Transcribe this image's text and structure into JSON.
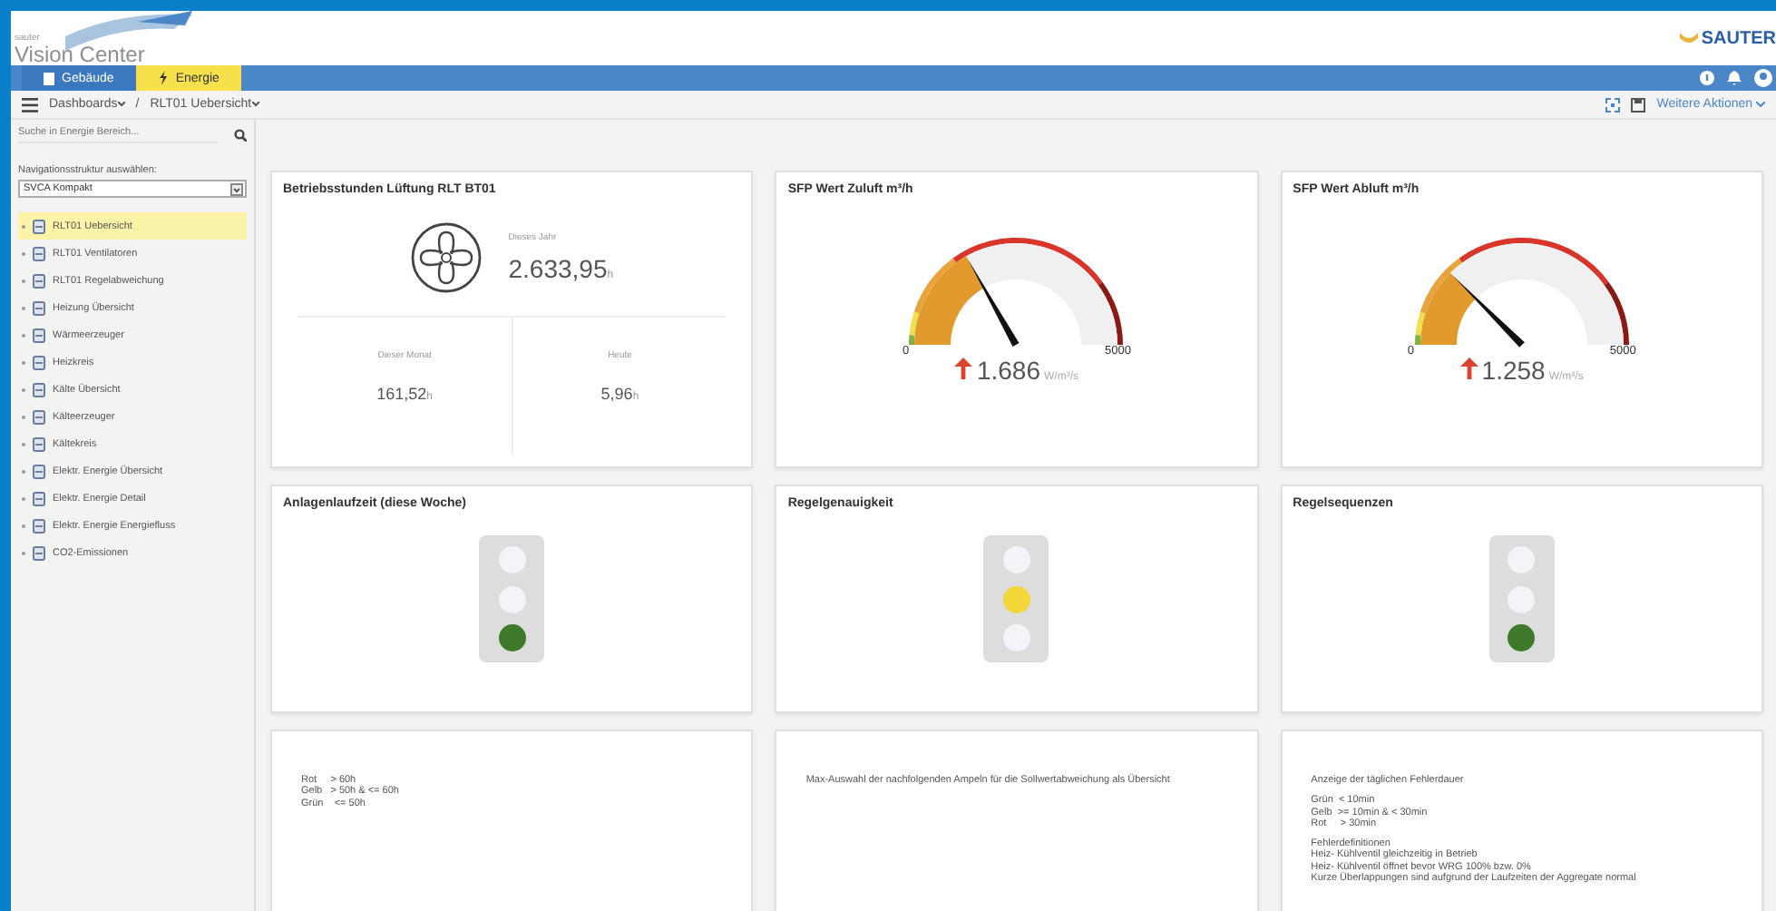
{
  "header": {
    "logo_small": "sauter",
    "logo": "Vision Center",
    "brand": "SAUTER"
  },
  "nav_tabs": [
    {
      "label": "Gebäude",
      "selected": false
    },
    {
      "label": "Energie",
      "selected": true
    }
  ],
  "breadcrumb": [
    {
      "label": "Dashboards"
    },
    {
      "label": "RLT01 Uebersicht"
    }
  ],
  "breadcrumb_separator": "/",
  "actions": {
    "more": "Weitere Aktionen"
  },
  "sidebar": {
    "search": {
      "placeholder": "Suche in Energie Bereich..."
    },
    "structure_label": "Navigationsstruktur auswählen:",
    "structure_value": "SVCA Kompakt",
    "items": [
      {
        "label": "RLT01 Uebersicht",
        "selected": true
      },
      {
        "label": "RLT01 Ventilatoren",
        "selected": false
      },
      {
        "label": "RLT01 Regelabweichung",
        "selected": false
      },
      {
        "label": "Heizung Übersicht",
        "selected": false
      },
      {
        "label": "Wärmeerzeuger",
        "selected": false
      },
      {
        "label": "Heizkreis",
        "selected": false
      },
      {
        "label": "Kälte Übersicht",
        "selected": false
      },
      {
        "label": "Kälteerzeuger",
        "selected": false
      },
      {
        "label": "Kältekreis",
        "selected": false
      },
      {
        "label": "Elektr. Energie Übersicht",
        "selected": false
      },
      {
        "label": "Elektr. Energie Detail",
        "selected": false
      },
      {
        "label": "Elektr. Energie Energiefluss",
        "selected": false
      },
      {
        "label": "CO2-Emissionen",
        "selected": false
      }
    ]
  },
  "cards": [
    {
      "kind": "hours",
      "title": "Betriebsstunden Lüftung RLT BT01",
      "main": {
        "label": "Dieses Jahr",
        "value": "2.633,95",
        "unit": "h"
      },
      "cells": [
        {
          "label": "Dieser Monat",
          "value": "161,52",
          "unit": "h"
        },
        {
          "label": "Heute",
          "value": "5,96",
          "unit": "h"
        }
      ]
    },
    {
      "kind": "gauge",
      "title": "SFP Wert Zuluft m³/h",
      "min": "0",
      "max": "5000",
      "value": "1.686",
      "unit": "W/m³/s",
      "level": 0.337
    },
    {
      "kind": "gauge",
      "title": "SFP Wert Abluft m³/h",
      "min": "0",
      "max": "5000",
      "value": "1.258",
      "unit": "W/m³/s",
      "level": 0.25
    },
    {
      "kind": "light",
      "title": "Anlagenlaufzeit (diese Woche)",
      "lamps": [
        {
          "on": false
        },
        {
          "on": false
        },
        {
          "on": true
        }
      ]
    },
    {
      "kind": "light",
      "title": "Regelgenauigkeit",
      "lamps": [
        {
          "on": false
        },
        {
          "on": true
        },
        {
          "on": false
        }
      ]
    },
    {
      "kind": "light",
      "title": "Regelsequenzen",
      "lamps": [
        {
          "on": false
        },
        {
          "on": false
        },
        {
          "on": true
        }
      ]
    },
    {
      "kind": "note",
      "paragraphs": [
        [
          "Rot     > 60h",
          "Gelb   > 50h & <= 60h",
          "Grün    <= 50h"
        ]
      ]
    },
    {
      "kind": "note",
      "paragraphs": [
        [
          "Max-Auswahl der nachfolgenden Ampeln für die Sollwertabweichung als Übersicht"
        ]
      ]
    },
    {
      "kind": "note",
      "paragraphs": [
        [
          "Anzeige der täglichen Fehlerdauer"
        ],
        [
          "Grün  < 10min",
          "Gelb  >= 10min & < 30min",
          "Rot     > 30min"
        ],
        [
          "Fehlerdefinitionen",
          "Heiz- Kühlventil gleichzeitig in Betrieb",
          "Heiz- Kühlventil öffnet bevor WRG 100% bzw. 0%",
          "Kurze Überlappungen sind aufgrund der Laufzeiten der Aggregate normal"
        ]
      ]
    }
  ]
}
